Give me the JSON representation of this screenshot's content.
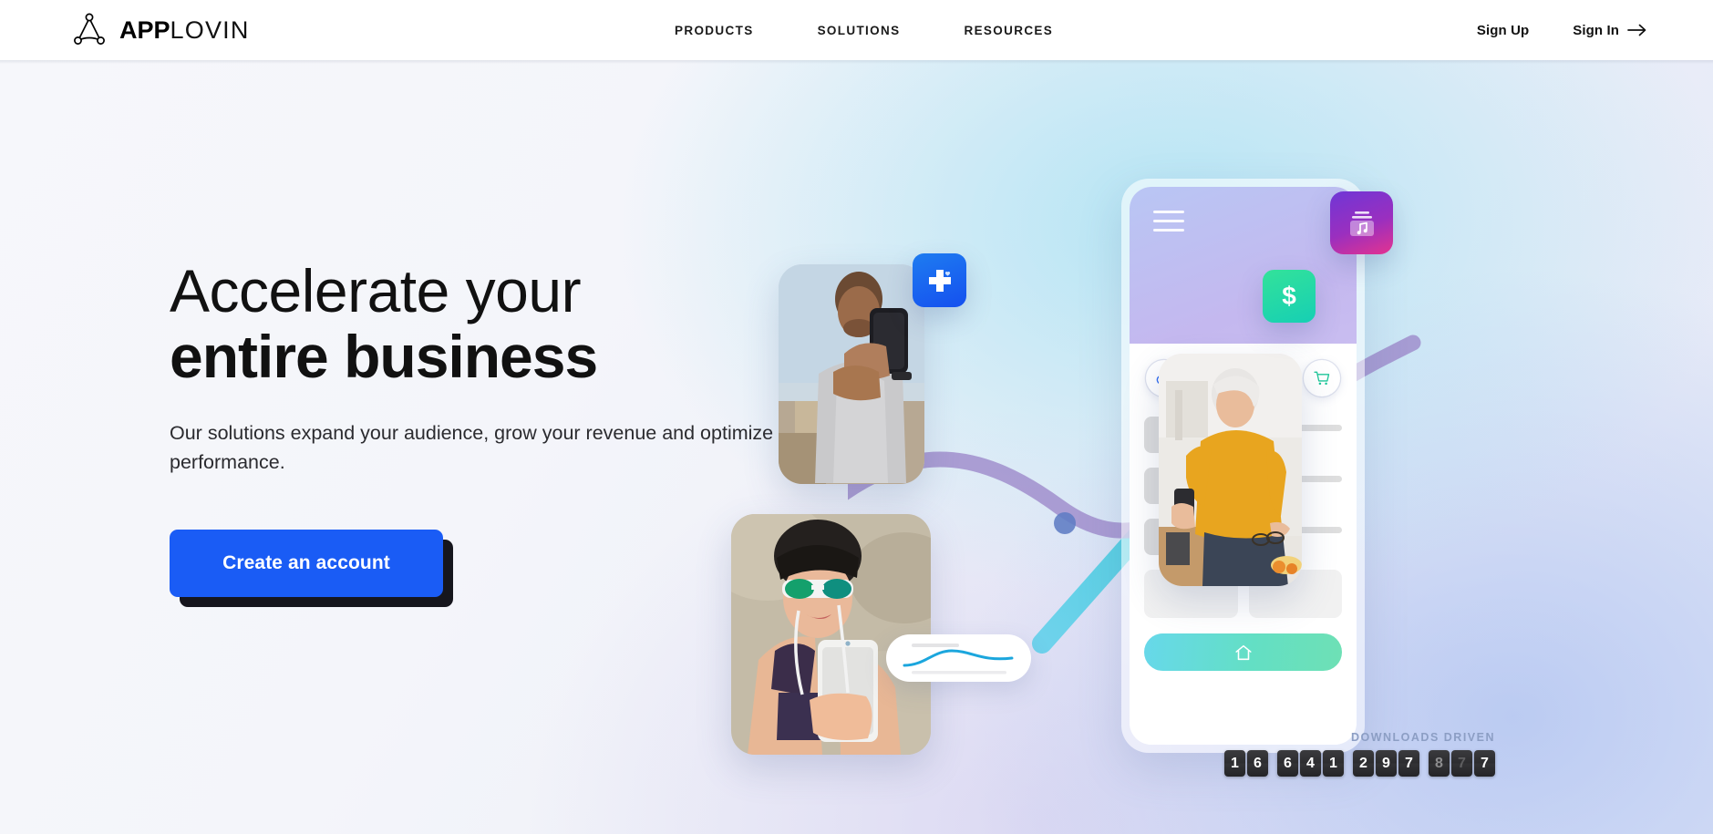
{
  "header": {
    "logo": {
      "bold": "APP",
      "light": "LOVIN",
      "icon": "applovin-triangle-logo"
    },
    "nav": [
      {
        "label": "PRODUCTS"
      },
      {
        "label": "SOLUTIONS"
      },
      {
        "label": "RESOURCES"
      }
    ],
    "auth": {
      "sign_up": "Sign Up",
      "sign_in": "Sign In",
      "sign_in_icon": "arrow-right-icon"
    }
  },
  "hero": {
    "headline_line1": "Accelerate your",
    "headline_line2": "entire business",
    "subheadline": "Our solutions expand your audience, grow your revenue and optimize your performance.",
    "cta_label": "Create an account",
    "cta_color": "#1a5cf5"
  },
  "art": {
    "phone": {
      "menu_icon": "hamburger-menu-icon",
      "categories": [
        {
          "name": "gamepad-icon",
          "color": "#2f6bf0"
        },
        {
          "name": "music-note-icon",
          "color": "#c53bd6"
        },
        {
          "name": "cutlery-icon",
          "color": "#f2541b"
        },
        {
          "name": "shopping-cart-icon",
          "color": "#1fc79a"
        }
      ],
      "list_rows": 3,
      "tiles": 2,
      "home_icon": "home-icon"
    },
    "floating_icons": [
      {
        "name": "medical-plus-app-icon",
        "color": "#1550ef"
      },
      {
        "name": "dollar-finance-app-icon",
        "color": "#16cfb4"
      },
      {
        "name": "music-playlist-app-icon",
        "color": "#9a2fbf"
      }
    ],
    "photos": [
      {
        "name": "photo-man-with-phone"
      },
      {
        "name": "photo-woman-at-beach"
      },
      {
        "name": "photo-woman-in-kitchen"
      }
    ],
    "sparkline_card": {
      "name": "analytics-sparkline-card",
      "line_color": "#1ba6dd"
    },
    "growth_arrow": {
      "name": "growth-arrow-icon",
      "color_start": "#5ec8e8",
      "color_end": "#3ddcaa"
    },
    "wave": {
      "name": "purple-wave-line",
      "color": "#9b87c9"
    }
  },
  "counter": {
    "label": "DOWNLOADS DRIVEN",
    "groups": [
      {
        "digits": [
          "1",
          "6"
        ],
        "state": "static"
      },
      {
        "digits": [
          "6",
          "4",
          "1"
        ],
        "state": "static"
      },
      {
        "digits": [
          "2",
          "9",
          "7"
        ],
        "state": "static"
      },
      {
        "digits": [
          "8",
          "7",
          "7"
        ],
        "state": "flipping"
      }
    ],
    "value": "16 641 297 877"
  }
}
